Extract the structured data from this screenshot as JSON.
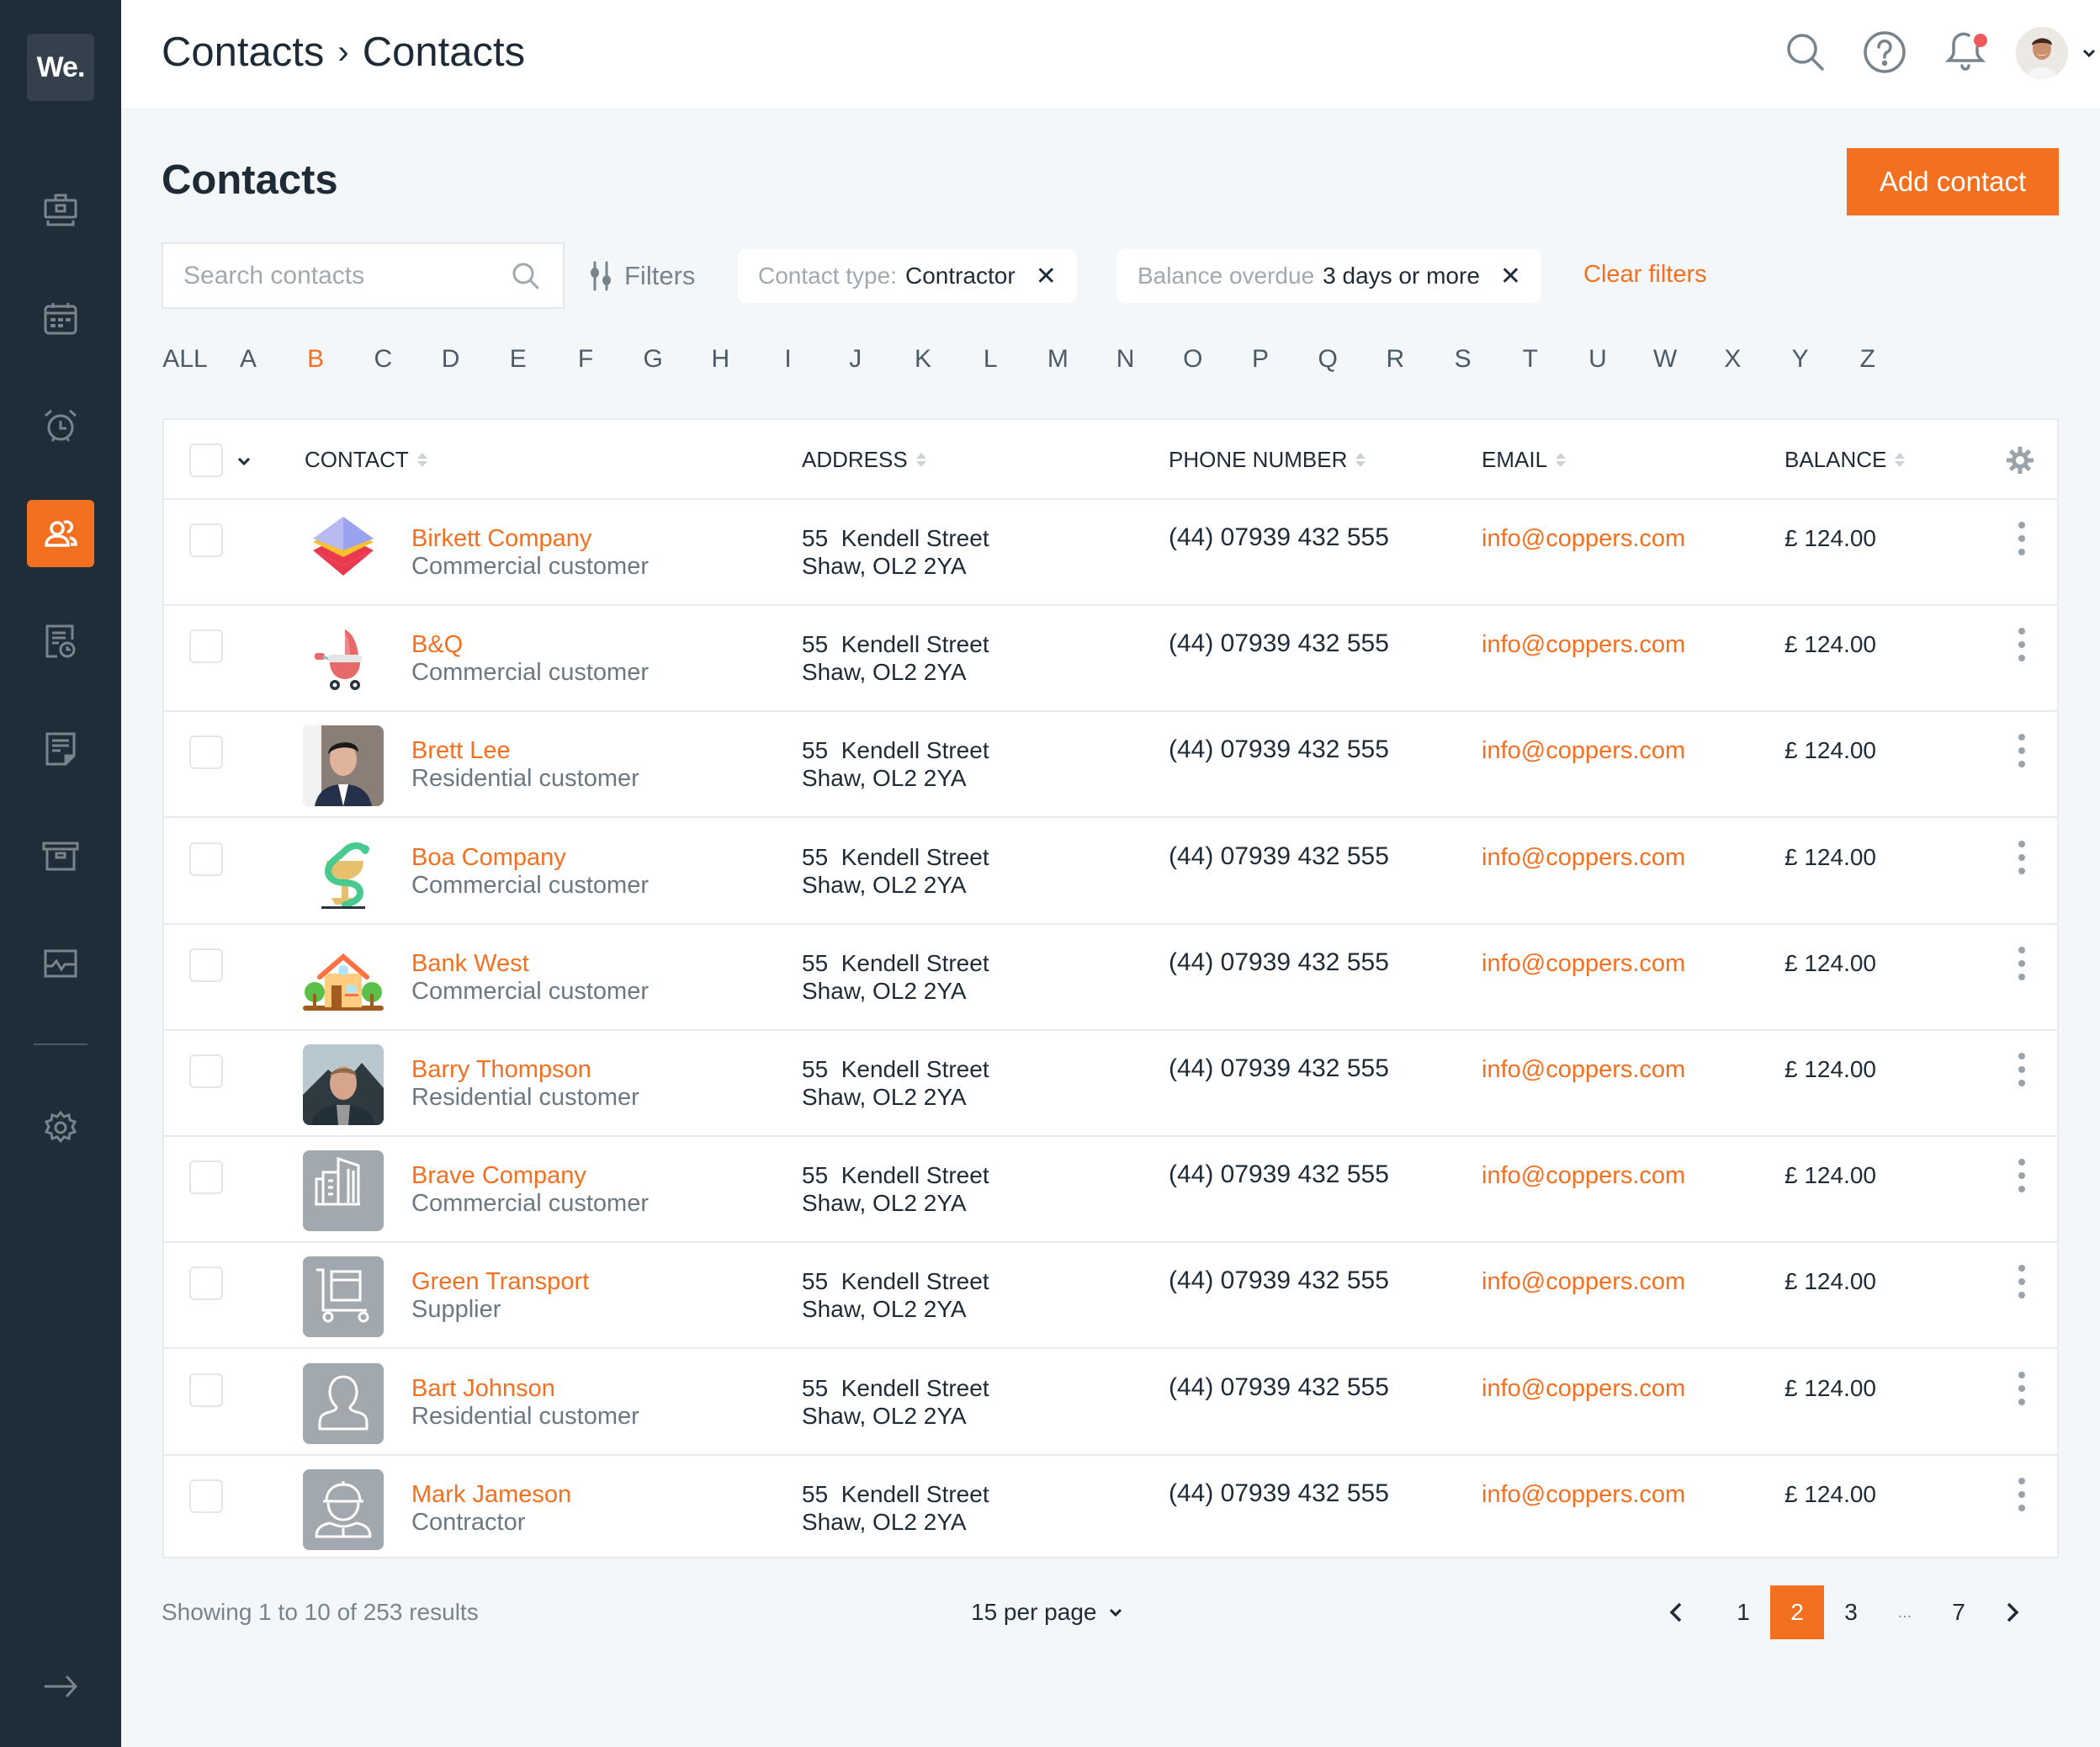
{
  "app": {
    "logo_text": "We."
  },
  "sidebar": {
    "items": [
      {
        "name": "jobs",
        "icon": "briefcase-icon",
        "active": false
      },
      {
        "name": "calendar",
        "icon": "calendar-icon",
        "active": false
      },
      {
        "name": "reminders",
        "icon": "alarm-clock-icon",
        "active": false
      },
      {
        "name": "contacts",
        "icon": "users-icon",
        "active": true
      },
      {
        "name": "timesheets",
        "icon": "document-clock-icon",
        "active": false
      },
      {
        "name": "notes",
        "icon": "note-icon",
        "active": false
      },
      {
        "name": "archive",
        "icon": "archive-box-icon",
        "active": false
      },
      {
        "name": "reports",
        "icon": "activity-chart-icon",
        "active": false
      },
      {
        "name": "settings",
        "icon": "gear-icon",
        "active": false
      }
    ],
    "expand_icon": "arrow-right-icon"
  },
  "header": {
    "breadcrumb": [
      "Contacts",
      "Contacts"
    ],
    "breadcrumb_separator": "›",
    "icons": [
      "search-icon",
      "help-icon",
      "bell-icon",
      "user-avatar"
    ],
    "notification_dot": true
  },
  "page": {
    "title": "Contacts",
    "add_button": "Add contact"
  },
  "search": {
    "placeholder": "Search contacts",
    "value": ""
  },
  "filters": {
    "button_label": "Filters",
    "chips": [
      {
        "label": "Contact type:",
        "value": "Contractor"
      },
      {
        "label": "Balance overdue",
        "value": "3 days or more"
      }
    ],
    "remove_glyph": "✕",
    "clear_label": "Clear filters"
  },
  "alphabet": {
    "letters": [
      "ALL",
      "A",
      "B",
      "C",
      "D",
      "E",
      "F",
      "G",
      "H",
      "I",
      "J",
      "K",
      "L",
      "M",
      "N",
      "O",
      "P",
      "Q",
      "R",
      "S",
      "T",
      "U",
      "W",
      "X",
      "Y",
      "Z"
    ],
    "active": "B"
  },
  "table": {
    "columns": {
      "contact": "CONTACT",
      "address": "ADDRESS",
      "phone": "PHONE NUMBER",
      "email": "EMAIL",
      "balance": "BALANCE"
    },
    "rows": [
      {
        "name": "Birkett Company",
        "type": "Commercial customer",
        "avatar": "layers-logo",
        "address1": "55  Kendell Street",
        "address2": "Shaw, OL2 2YA",
        "phone": "(44) 07939 432 555",
        "email": "info@coppers.com",
        "balance": "£ 124.00"
      },
      {
        "name": "B&Q",
        "type": "Commercial customer",
        "avatar": "pram-logo",
        "address1": "55  Kendell Street",
        "address2": "Shaw, OL2 2YA",
        "phone": "(44) 07939 432 555",
        "email": "info@coppers.com",
        "balance": "£ 124.00"
      },
      {
        "name": "Brett Lee",
        "type": "Residential customer",
        "avatar": "photo-man-suit",
        "address1": "55  Kendell Street",
        "address2": "Shaw, OL2 2YA",
        "phone": "(44) 07939 432 555",
        "email": "info@coppers.com",
        "balance": "£ 124.00"
      },
      {
        "name": "Boa Company",
        "type": "Commercial customer",
        "avatar": "snake-cup-logo",
        "address1": "55  Kendell Street",
        "address2": "Shaw, OL2 2YA",
        "phone": "(44) 07939 432 555",
        "email": "info@coppers.com",
        "balance": "£ 124.00"
      },
      {
        "name": "Bank West",
        "type": "Commercial customer",
        "avatar": "house-logo",
        "address1": "55  Kendell Street",
        "address2": "Shaw, OL2 2YA",
        "phone": "(44) 07939 432 555",
        "email": "info@coppers.com",
        "balance": "£ 124.00"
      },
      {
        "name": "Barry Thompson",
        "type": "Residential customer",
        "avatar": "photo-man-mountain",
        "address1": "55  Kendell Street",
        "address2": "Shaw, OL2 2YA",
        "phone": "(44) 07939 432 555",
        "email": "info@coppers.com",
        "balance": "£ 124.00"
      },
      {
        "name": "Brave Company",
        "type": "Commercial customer",
        "avatar": "building-placeholder",
        "address1": "55  Kendell Street",
        "address2": "Shaw, OL2 2YA",
        "phone": "(44) 07939 432 555",
        "email": "info@coppers.com",
        "balance": "£ 124.00"
      },
      {
        "name": "Green Transport",
        "type": "Supplier",
        "avatar": "trolley-placeholder",
        "address1": "55  Kendell Street",
        "address2": "Shaw, OL2 2YA",
        "phone": "(44) 07939 432 555",
        "email": "info@coppers.com",
        "balance": "£ 124.00"
      },
      {
        "name": "Bart Johnson",
        "type": "Residential customer",
        "avatar": "person-placeholder",
        "address1": "55  Kendell Street",
        "address2": "Shaw, OL2 2YA",
        "phone": "(44) 07939 432 555",
        "email": "info@coppers.com",
        "balance": "£ 124.00"
      },
      {
        "name": "Mark Jameson",
        "type": "Contractor",
        "avatar": "hardhat-placeholder",
        "address1": "55  Kendell Street",
        "address2": "Shaw, OL2 2YA",
        "phone": "(44) 07939 432 555",
        "email": "info@coppers.com",
        "balance": "£ 124.00"
      }
    ]
  },
  "footer": {
    "showing": "Showing 1 to 10 of 253 results",
    "per_page": "15 per page",
    "pages": [
      "1",
      "2",
      "3",
      "...",
      "7"
    ],
    "current_page": "2"
  },
  "colors": {
    "accent": "#f37021",
    "sidebar_bg": "#1f2d38",
    "page_bg": "#f4f7fa",
    "text": "#1e2b37",
    "muted": "#78848d"
  }
}
